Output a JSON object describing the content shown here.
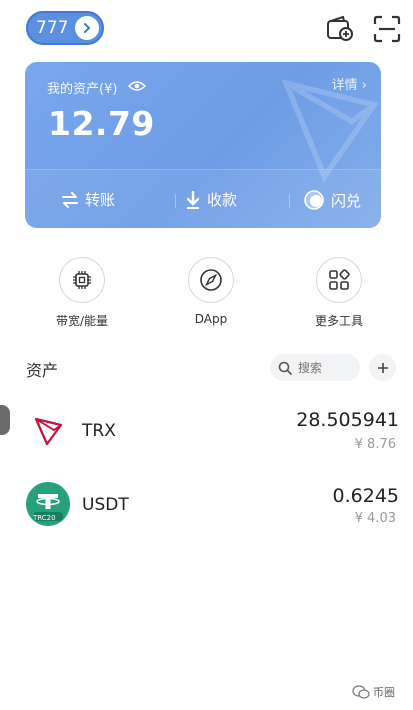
{
  "header": {
    "wallet_name": "777"
  },
  "asset_card": {
    "title": "我的资产(¥)",
    "detail": "详情 ›",
    "balance": "12.79",
    "actions": [
      {
        "label": "转账",
        "icon": "transfer-icon"
      },
      {
        "label": "收款",
        "icon": "receive-icon"
      },
      {
        "label": "闪兑",
        "icon": "swap-icon"
      }
    ]
  },
  "tools": [
    {
      "label": "带宽/能量",
      "icon": "chip-icon"
    },
    {
      "label": "DApp",
      "icon": "compass-icon"
    },
    {
      "label": "更多工具",
      "icon": "grid-icon"
    }
  ],
  "assets": {
    "heading": "资产",
    "search_placeholder": "搜索",
    "tokens": [
      {
        "symbol": "TRX",
        "amount": "28.505941",
        "fiat": "¥ 8.76",
        "icon": "tron-logo"
      },
      {
        "symbol": "USDT",
        "amount": "0.6245",
        "fiat": "¥ 4.03",
        "icon": "tether-trc20-logo"
      }
    ],
    "usdt_badge": "TRC20"
  },
  "watermark": "币圈",
  "colors": {
    "card_blue": "#74a2ea",
    "tron_red": "#c4123c",
    "tether_green": "#26a17b"
  }
}
